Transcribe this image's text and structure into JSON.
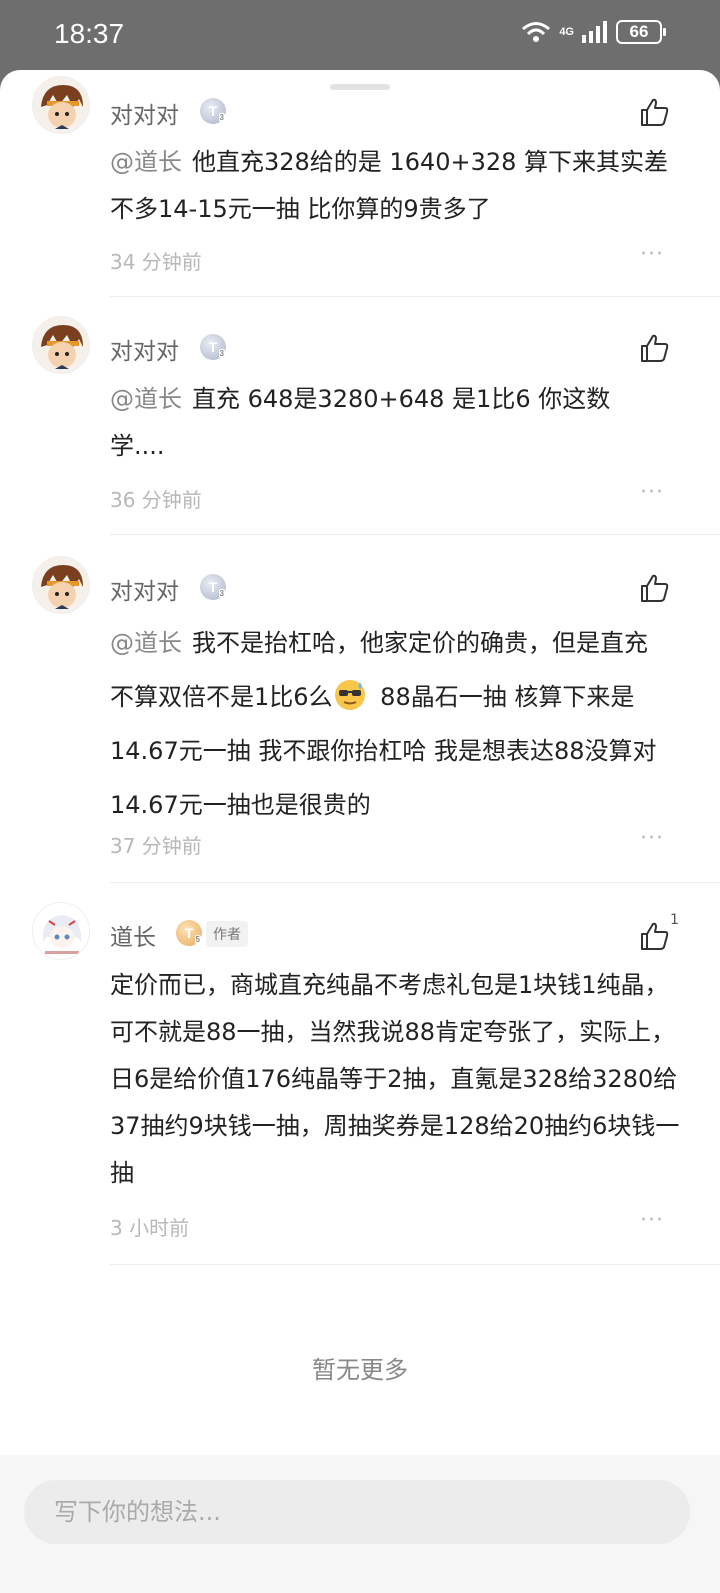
{
  "status_bar": {
    "time": "18:37",
    "network": "4G",
    "battery": "66"
  },
  "comments": [
    {
      "username": "对对对",
      "level": "T",
      "mention": "@道长",
      "text": "他直充328给的是 1640+328 算下来其实差不多14-15元一抽 比你算的9贵多了",
      "time": "34 分钟前"
    },
    {
      "username": "对对对",
      "level": "T",
      "mention": "@道长",
      "text": "直充 648是3280+648 是1比6 你这数学....",
      "time": "36 分钟前"
    },
    {
      "username": "对对对",
      "level": "T",
      "mention": "@道长",
      "text_before_emoji": "我不是抬杠哈，他家定价的确贵，但是直充不算双倍不是1比6么",
      "emoji": "sweat-smile-sunglasses-emoji",
      "text_after_emoji": " 88晶石一抽 核算下来是14.67元一抽 我不跟你抬杠哈 我是想表达88没算对 14.67元一抽也是很贵的",
      "time": "37 分钟前"
    },
    {
      "username": "道长",
      "level": "T",
      "author_tag": "作者",
      "like_count": "1",
      "text": "定价而已，商城直充纯晶不考虑礼包是1块钱1纯晶，可不就是88一抽，当然我说88肯定夸张了，实际上，日6是给价值176纯晶等于2抽，直氪是328给3280给37抽约9块钱一抽，周抽奖券是128给20抽约6块钱一抽",
      "time": "3 小时前"
    }
  ],
  "no_more": "暂无更多",
  "composer": {
    "placeholder": "写下你的想法..."
  },
  "more_icon": "···",
  "colors": {
    "mention": "#888888",
    "time": "#b8b8b8",
    "gold_badge": "#e8a95b"
  }
}
